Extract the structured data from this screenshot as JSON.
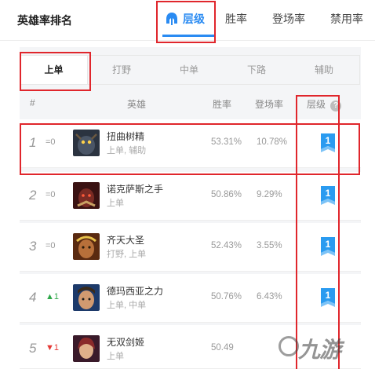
{
  "header": {
    "title": "英雄率排名",
    "tabs": [
      {
        "label": "层级",
        "icon": "helmet-icon",
        "active": true
      },
      {
        "label": "胜率"
      },
      {
        "label": "登场率"
      },
      {
        "label": "禁用率"
      }
    ]
  },
  "roles": [
    "上单",
    "打野",
    "中单",
    "下路",
    "辅助"
  ],
  "columns": {
    "rank": "#",
    "hero": "英雄",
    "winrate": "胜率",
    "pickrate": "登场率",
    "tier": "层级",
    "help": "?"
  },
  "rows": [
    {
      "rank": "1",
      "trend": "=0",
      "trend_dir": "same",
      "name": "扭曲树精",
      "roles": "上单, 辅助",
      "winrate": "53.31%",
      "pickrate": "10.78%",
      "tier": "1"
    },
    {
      "rank": "2",
      "trend": "=0",
      "trend_dir": "same",
      "name": "诺克萨斯之手",
      "roles": "上单",
      "winrate": "50.86%",
      "pickrate": "9.29%",
      "tier": "1"
    },
    {
      "rank": "3",
      "trend": "=0",
      "trend_dir": "same",
      "name": "齐天大圣",
      "roles": "打野, 上单",
      "winrate": "52.43%",
      "pickrate": "3.55%",
      "tier": "1"
    },
    {
      "rank": "4",
      "trend": "▲1",
      "trend_dir": "up",
      "name": "德玛西亚之力",
      "roles": "上单, 中单",
      "winrate": "50.76%",
      "pickrate": "6.43%",
      "tier": "1"
    },
    {
      "rank": "5",
      "trend": "▼1",
      "trend_dir": "down",
      "name": "无双剑姬",
      "roles": "上单",
      "winrate": "50.49",
      "pickrate": "",
      "tier": ""
    }
  ],
  "colors": {
    "accent": "#2a8bf2",
    "tier_badge": "#2a9bf0",
    "highlight": "#e0262c",
    "up": "#2ea84a",
    "down": "#e53935"
  },
  "watermark": "九游"
}
